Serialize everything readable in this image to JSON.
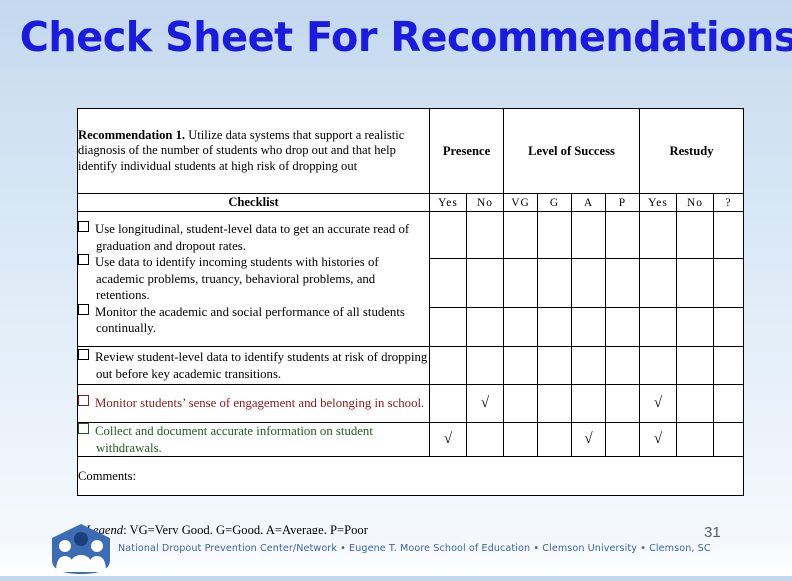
{
  "slide": {
    "title": "Check Sheet For Recommendations",
    "page_number": "31",
    "title_color": "#1a1ae0",
    "background_top": "#c3d8ee",
    "background_bottom": "#f7fbfe"
  },
  "table": {
    "recommendation_label": "Recommendation 1.",
    "recommendation_text": " Utilize data systems that support a realistic diagnosis of the number of students who drop out and that help identify individual students at high risk of dropping out",
    "group_headers": [
      {
        "label": "Presence",
        "span": 2
      },
      {
        "label": "Level of Success",
        "span": 4
      },
      {
        "label": "Restudy",
        "span": 3
      }
    ],
    "checklist_header": "Checklist",
    "sub_headers": [
      "Yes",
      "No",
      "VG",
      "G",
      "A",
      "P",
      "Yes",
      "No",
      "?"
    ],
    "check_glyph": "√",
    "checkbox_glyph": "❑",
    "rows": [
      {
        "text": "Use longitudinal, student-level data to get an accurate read of graduation and dropout rates.",
        "color": "normal",
        "marks": [
          false,
          false,
          false,
          false,
          false,
          false,
          false,
          false,
          false
        ]
      },
      {
        "text": "Use data to identify incoming students with histories of academic problems, truancy, behavioral problems, and retentions.",
        "color": "normal",
        "marks": [
          false,
          false,
          false,
          false,
          false,
          false,
          false,
          false,
          false
        ]
      },
      {
        "text": "Monitor the academic and social performance of all students continually.",
        "color": "normal",
        "marks": [
          false,
          false,
          false,
          false,
          false,
          false,
          false,
          false,
          false
        ]
      },
      {
        "text": "Review student-level data to identify students at risk of dropping out before key academic transitions.",
        "color": "normal",
        "marks": [
          false,
          false,
          false,
          false,
          false,
          false,
          false,
          false,
          false
        ]
      },
      {
        "text": "Monitor students’ sense of engagement and belonging in school.",
        "color": "red",
        "marks": [
          false,
          true,
          false,
          false,
          false,
          false,
          true,
          false,
          false
        ]
      },
      {
        "text": "Collect and document accurate information on student withdrawals.",
        "color": "green",
        "marks": [
          true,
          false,
          false,
          false,
          true,
          false,
          true,
          false,
          false
        ]
      }
    ],
    "comments_label": "Comments:"
  },
  "legend": {
    "label": "Legend",
    "text": ": VG=Very Good, G=Good, A=Average, P=Poor"
  },
  "footer": {
    "organization": "National Dropout Prevention Center/Network • Eugene T. Moore School of Education • Clemson University • Clemson, SC",
    "logo_name": "ndpc-shield-logo",
    "logo_color": "#3b6cb5"
  }
}
